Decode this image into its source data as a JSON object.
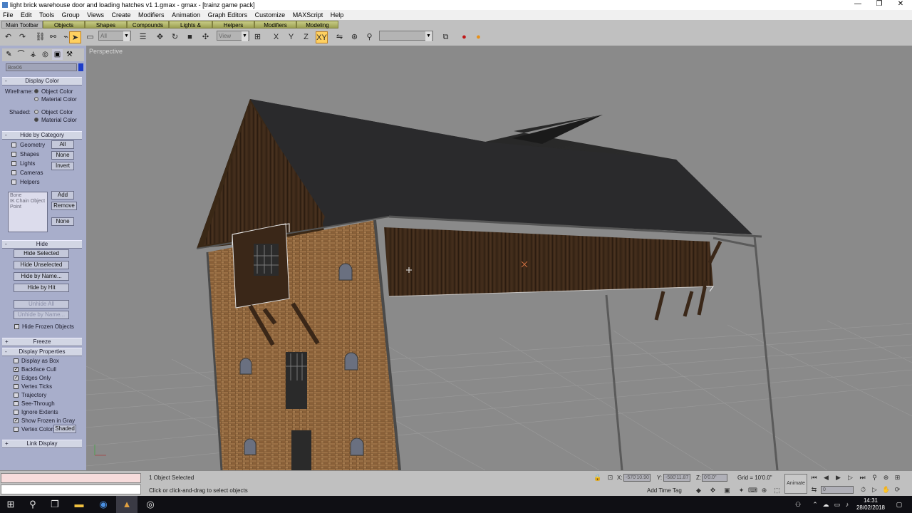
{
  "window": {
    "title": "light brick warehouse door and loading hatches v1 1.gmax - gmax - [trainz game pack]",
    "minimize_glyph": "—",
    "restore_glyph": "❐",
    "close_glyph": "✕"
  },
  "menu": [
    "File",
    "Edit",
    "Tools",
    "Group",
    "Views",
    "Create",
    "Modifiers",
    "Animation",
    "Graph Editors",
    "Customize",
    "MAXScript",
    "Help"
  ],
  "tabs": [
    "Main Toolbar",
    "Objects",
    "Shapes",
    "Compounds",
    "Lights & Cameras",
    "Helpers",
    "Modifiers",
    "Modeling"
  ],
  "toolbar": {
    "filter_value": "All",
    "coord_value": "View",
    "selection_set_value": "",
    "icons": [
      "undo-icon",
      "redo-icon",
      "select-link-icon",
      "unlink-icon",
      "bind-space-warp-icon",
      "select-object-icon",
      "region-select-icon",
      "select-by-name-icon",
      "move-icon",
      "rotate-icon",
      "scale-icon",
      "pivot-icon",
      "mirror-icon",
      "align-icon",
      "axis-x-icon",
      "axis-y-icon",
      "axis-z-icon",
      "axis-xy-icon",
      "snap-icon",
      "angle-snap-icon",
      "percent-snap-icon",
      "named-selection-icon",
      "render-icon",
      "quick-render-icon"
    ],
    "axis_labels": {
      "x": "X",
      "y": "Y",
      "z": "Z",
      "xy": "XY"
    }
  },
  "command_panel": {
    "object_name": "Box06",
    "display_color": {
      "title": "Display Color",
      "wireframe_label": "Wireframe:",
      "shaded_label": "Shaded:",
      "object_color": "Object Color",
      "material_color": "Material Color"
    },
    "hide_by_category": {
      "title": "Hide by Category",
      "items": [
        "Geometry",
        "Shapes",
        "Lights",
        "Cameras",
        "Helpers"
      ],
      "buttons": [
        "All",
        "None",
        "Invert"
      ],
      "list": [
        "Bone",
        "IK Chain Object",
        "Point"
      ],
      "list_buttons": [
        "Add",
        "Remove",
        "None"
      ]
    },
    "hide": {
      "title": "Hide",
      "buttons": [
        "Hide Selected",
        "Hide Unselected",
        "Hide by Name...",
        "Hide by Hit"
      ],
      "disabled_buttons": [
        "Unhide All",
        "Unhide by Name..."
      ],
      "hide_frozen": "Hide Frozen Objects"
    },
    "freeze": {
      "title": "Freeze"
    },
    "display_properties": {
      "title": "Display Properties",
      "items": [
        {
          "label": "Display as Box",
          "checked": false
        },
        {
          "label": "Backface Cull",
          "checked": true
        },
        {
          "label": "Edges Only",
          "checked": true
        },
        {
          "label": "Vertex Ticks",
          "checked": false
        },
        {
          "label": "Trajectory",
          "checked": false
        },
        {
          "label": "See-Through",
          "checked": false
        },
        {
          "label": "Ignore Extents",
          "checked": false
        },
        {
          "label": "Show Frozen in Gray",
          "checked": true
        },
        {
          "label": "Vertex Colors",
          "checked": false
        }
      ],
      "shaded_button": "Shaded"
    },
    "link_display": {
      "title": "Link Display"
    },
    "plus": "+",
    "minus": "-",
    "check_glyph": "✓"
  },
  "viewport": {
    "label": "Perspective"
  },
  "status": {
    "selection": "1 Object Selected",
    "prompt": "Click or click-and-drag to select objects",
    "x_label": "X:",
    "y_label": "Y:",
    "z_label": "Z:",
    "x_value": "-570'10.90",
    "y_value": "-580'11.87",
    "z_value": "0'0.0\"",
    "grid": "Grid = 10'0.0\"",
    "add_time_tag": "Add Time Tag",
    "animate": "Animate",
    "frame": "0"
  },
  "taskbar": {
    "time": "14:31",
    "date": "28/02/2018",
    "icons": [
      "windows-start-icon",
      "search-icon",
      "task-view-icon",
      "file-explorer-icon",
      "chrome-icon",
      "gmax-icon",
      "obs-icon"
    ]
  },
  "colors": {
    "accent_tab": "#b8bc6a",
    "panel": "#a8aecb",
    "selection_swatch": "#1c3cc8",
    "viewport_bg": "#8a8a8a"
  }
}
